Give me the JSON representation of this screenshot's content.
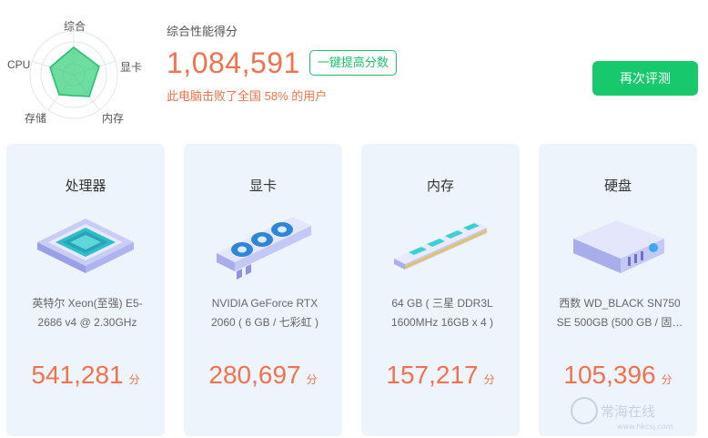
{
  "radar": {
    "labels": {
      "top": "综合",
      "right": "显卡",
      "bottom_right": "内存",
      "bottom_left": "存储",
      "left": "CPU"
    },
    "accent": "#1fc26b"
  },
  "summary": {
    "title": "综合性能得分",
    "score": "1,084,591",
    "boost_label": "一键提高分数",
    "beat_text": "此电脑击败了全国 58% 的用户"
  },
  "retest_label": "再次评测",
  "cards": [
    {
      "title": "处理器",
      "icon": "cpu-chip-icon",
      "desc": "英特尔 Xeon(至强) E5-2686 v4 @ 2.30GHz",
      "score": "541,281",
      "unit": "分"
    },
    {
      "title": "显卡",
      "icon": "graphics-card-icon",
      "desc": "NVIDIA GeForce RTX 2060 ( 6 GB / 七彩虹 )",
      "score": "280,697",
      "unit": "分"
    },
    {
      "title": "内存",
      "icon": "memory-stick-icon",
      "desc": "64 GB ( 三星 DDR3L 1600MHz 16GB x 4 )",
      "score": "157,217",
      "unit": "分"
    },
    {
      "title": "硬盘",
      "icon": "hard-drive-icon",
      "desc": "西数 WD_BLACK SN750 SE 500GB (500 GB / 固…",
      "score": "105,396",
      "unit": "分"
    }
  ],
  "colors": {
    "accent_green": "#17c96c",
    "score_orange": "#f1724e",
    "card_bg": "#eef4fc"
  },
  "watermark": "www.hkcsj.com"
}
